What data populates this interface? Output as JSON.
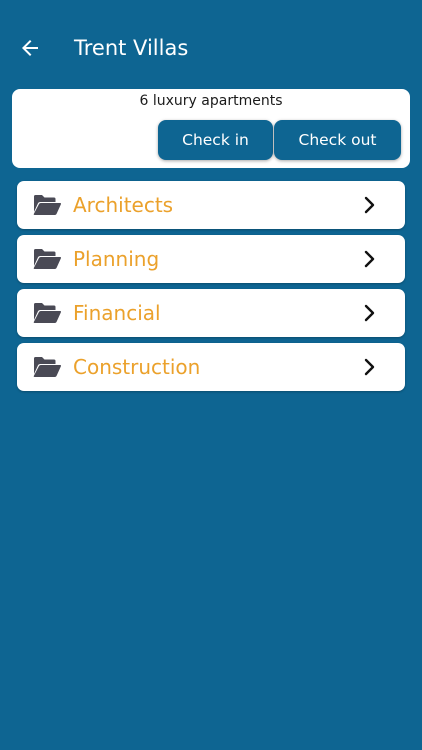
{
  "header": {
    "title": "Trent Villas",
    "back_icon": "arrow-left-icon"
  },
  "info_card": {
    "description": "6 luxury apartments",
    "check_in_label": "Check in",
    "check_out_label": "Check out"
  },
  "folders": [
    {
      "label": "Architects",
      "icon": "folder-open-icon"
    },
    {
      "label": "Planning",
      "icon": "folder-open-icon"
    },
    {
      "label": "Financial",
      "icon": "folder-open-icon"
    },
    {
      "label": "Construction",
      "icon": "folder-open-icon"
    }
  ],
  "colors": {
    "background": "#0e6592",
    "card": "#ffffff",
    "folder_label": "#eba12b",
    "folder_icon": "#4a4a55",
    "text_dark": "#1b1b1b"
  }
}
